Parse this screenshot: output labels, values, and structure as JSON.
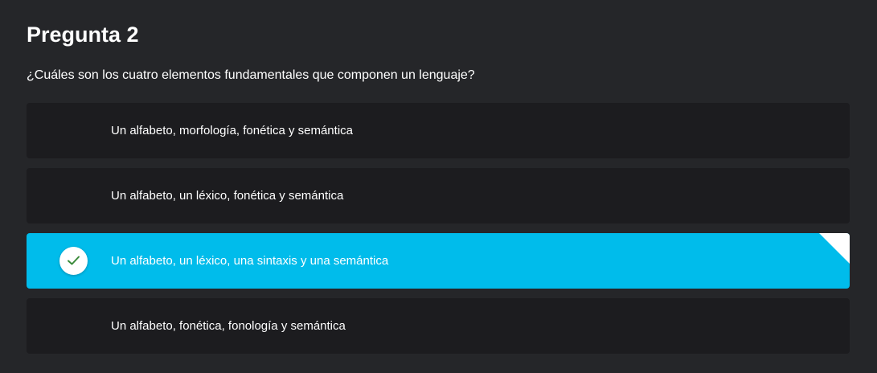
{
  "question": {
    "title": "Pregunta 2",
    "text": "¿Cuáles son los cuatro elementos fundamentales que componen un lenguaje?"
  },
  "options": [
    {
      "label": "Un alfabeto, morfología, fonética y semántica",
      "selected": false
    },
    {
      "label": "Un alfabeto, un léxico, fonética y semántica",
      "selected": false
    },
    {
      "label": "Un alfabeto, un léxico, una sintaxis y una semántica",
      "selected": true
    },
    {
      "label": "Un alfabeto, fonética, fonología y semántica",
      "selected": false
    }
  ],
  "icons": {
    "selected_option": "check-icon",
    "selected_corner": "corner-fold-icon"
  },
  "colors": {
    "background": "#252629",
    "option_background": "#1c1c1f",
    "selected_background": "#00bceb",
    "check_color": "#3a8a3a"
  }
}
